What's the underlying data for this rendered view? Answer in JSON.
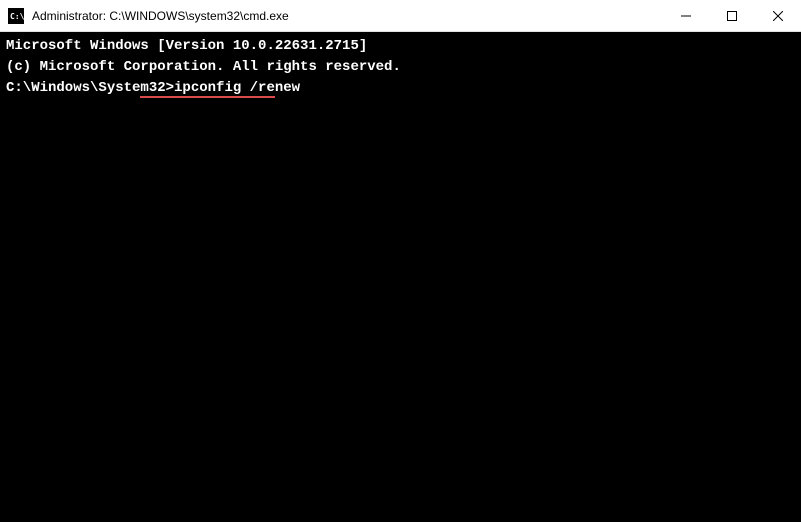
{
  "titlebar": {
    "title": "Administrator: C:\\WINDOWS\\system32\\cmd.exe",
    "icon_name": "cmd-icon"
  },
  "terminal": {
    "line1": "Microsoft Windows [Version 10.0.22631.2715]",
    "line2": "(c) Microsoft Corporation. All rights reserved.",
    "blank": "",
    "prompt": "C:\\Windows\\System32>",
    "command": "ipconfig /renew"
  }
}
